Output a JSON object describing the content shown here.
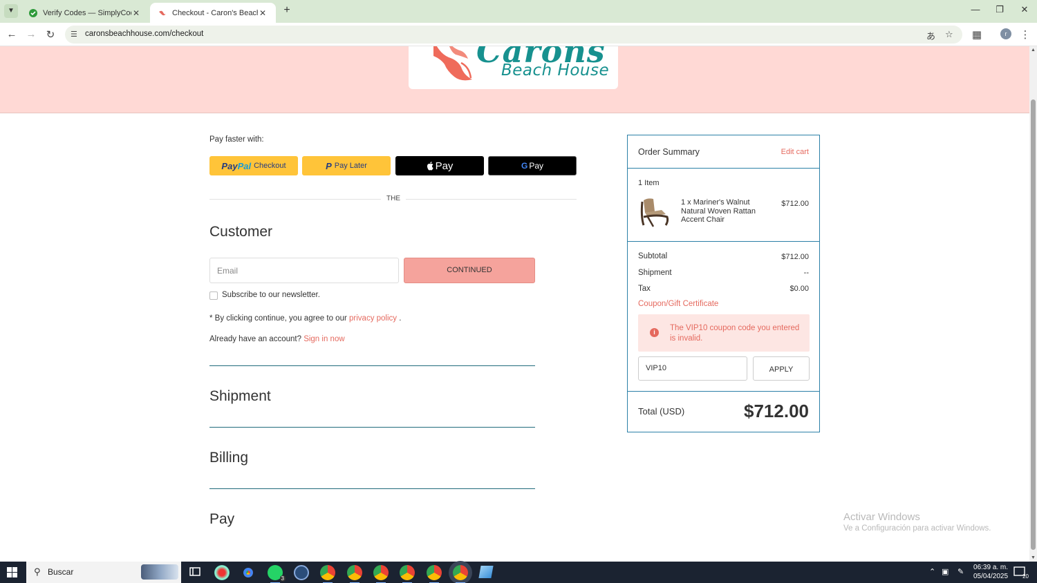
{
  "browser": {
    "tabs": [
      {
        "title": "Verify Codes — SimplyCodes",
        "active": false
      },
      {
        "title": "Checkout - Caron's Beach House",
        "active": true
      }
    ],
    "url": "caronsbeachhouse.com/checkout",
    "profile_initial": "r"
  },
  "logo": {
    "brand": "Carons",
    "subtitle": "Beach House"
  },
  "express": {
    "label": "Pay faster with:",
    "paypal_a": "Pay",
    "paypal_b": "Pal",
    "paypal_checkout": "Checkout",
    "paylater_label": "Pay Later",
    "applepay_label": "Pay",
    "gpay_label": "Pay",
    "divider": "THE"
  },
  "customer": {
    "title": "Customer",
    "email_placeholder": "Email",
    "continue_label": "CONTINUED",
    "newsletter_label": "Subscribe to our newsletter.",
    "agree_prefix": "* By clicking continue, you agree to our",
    "privacy_link": "privacy policy",
    "agree_suffix": ".",
    "account_prefix": "Already have an account?",
    "signin_link": "Sign in now"
  },
  "sections": {
    "shipment": "Shipment",
    "billing": "Billing",
    "pay": "Pay"
  },
  "summary": {
    "title": "Order Summary",
    "edit_cart": "Edit cart",
    "item_count": "1 Item",
    "item_name": "1 x Mariner's Walnut Natural Woven Rattan Accent Chair",
    "item_price": "$712.00",
    "subtotal_label": "Subtotal",
    "subtotal_value": "$712.00",
    "shipment_label": "Shipment",
    "shipment_value": "--",
    "tax_label": "Tax",
    "tax_value": "$0.00",
    "coupon_link": "Coupon/Gift Certificate",
    "alert_text": "The VIP10 coupon code you entered is invalid.",
    "coupon_value": "VIP10",
    "apply_label": "APPLY",
    "total_label": "Total (USD)",
    "total_value": "$712.00"
  },
  "watermark": {
    "title": "Activar Windows",
    "subtitle": "Ve a Configuración para activar Windows."
  },
  "taskbar": {
    "search_placeholder": "Buscar",
    "time": "06:39 a. m.",
    "date": "05/04/2025",
    "whatsapp_badge": "3",
    "notifications_count": "20"
  },
  "colors": {
    "header_band": "#ffd9d5",
    "accent_coral": "#e5695e",
    "continue_bg": "#f5a39c",
    "summary_border": "#2a7fa7",
    "brand_teal": "#17918f",
    "paypal_yellow": "#ffc439"
  }
}
